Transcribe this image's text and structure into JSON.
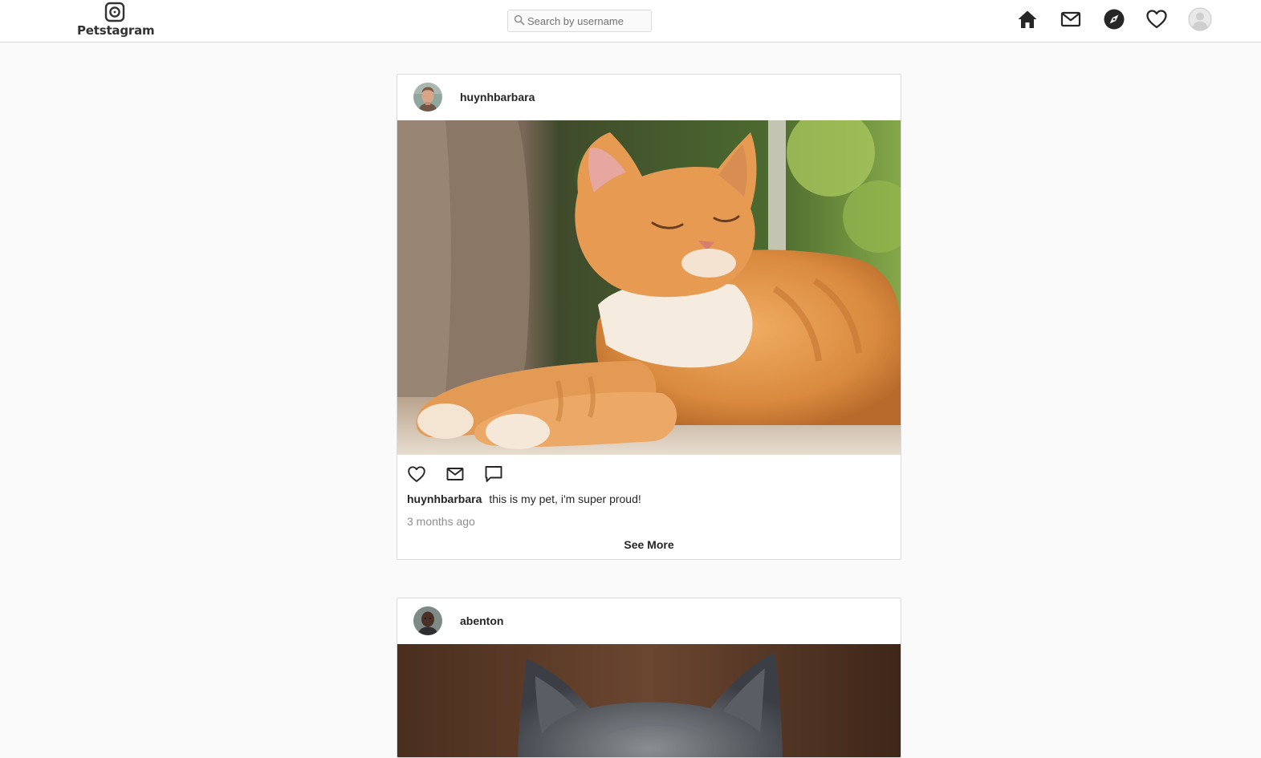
{
  "app": {
    "name": "Petstagram"
  },
  "header": {
    "logo_icon": "camera-logo-icon",
    "search": {
      "placeholder": "Search by username",
      "value": "",
      "icon": "search-icon"
    },
    "nav": [
      {
        "name": "home",
        "icon": "home-icon"
      },
      {
        "name": "messages",
        "icon": "mail-icon"
      },
      {
        "name": "explore",
        "icon": "compass-icon"
      },
      {
        "name": "activity",
        "icon": "heart-icon"
      },
      {
        "name": "profile",
        "icon": "avatar-icon"
      }
    ]
  },
  "feed": {
    "posts": [
      {
        "username": "huynhbarbara",
        "image_subject": "orange tabby cat sunbathing",
        "actions": [
          "heart-icon",
          "mail-icon",
          "comment-icon"
        ],
        "caption_user": "huynhbarbara",
        "caption": "this is my pet, i'm super proud!",
        "time_ago": "3 months ago",
        "see_more_label": "See More"
      },
      {
        "username": "abenton",
        "image_subject": "grey cat"
      }
    ]
  },
  "colors": {
    "background": "#fafafa",
    "surface": "#ffffff",
    "border": "#dbdbdb",
    "text": "#262626",
    "muted": "#8e8e8e",
    "icon": "#262626"
  }
}
